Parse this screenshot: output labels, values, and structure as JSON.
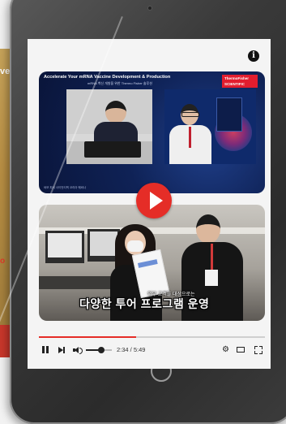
{
  "background": {
    "left_text": "ve",
    "left_red_text": "o"
  },
  "player": {
    "info_label": "i",
    "video1": {
      "banner_title": "Accelerate Your mRNA Vaccine Development & Production",
      "banner_subtitle": "mRNA 백신 개발을 위한 Thermo Fisher 솔루션",
      "brand_logo": "ThermoFisher SCIENTIFIC",
      "footer_caption": "써모 피셔 사이언티픽 코리아 웨비나"
    },
    "video2": {
      "subtitle_small": "외부 고객을 대상으로는",
      "subtitle_large": "다양한 투어 프로그램 운영"
    },
    "progress": 0.43,
    "volume": 0.6,
    "time_display": "2:34 / 5:49",
    "icons": {
      "play": "play-icon",
      "pause": "pause-icon",
      "next": "next-icon",
      "volume": "volume-icon",
      "settings": "gear-icon",
      "theater": "theater-mode-icon",
      "fullscreen": "fullscreen-icon"
    },
    "colors": {
      "accent": "#e52d27",
      "tablet_frame": "#2b2b2b"
    }
  }
}
